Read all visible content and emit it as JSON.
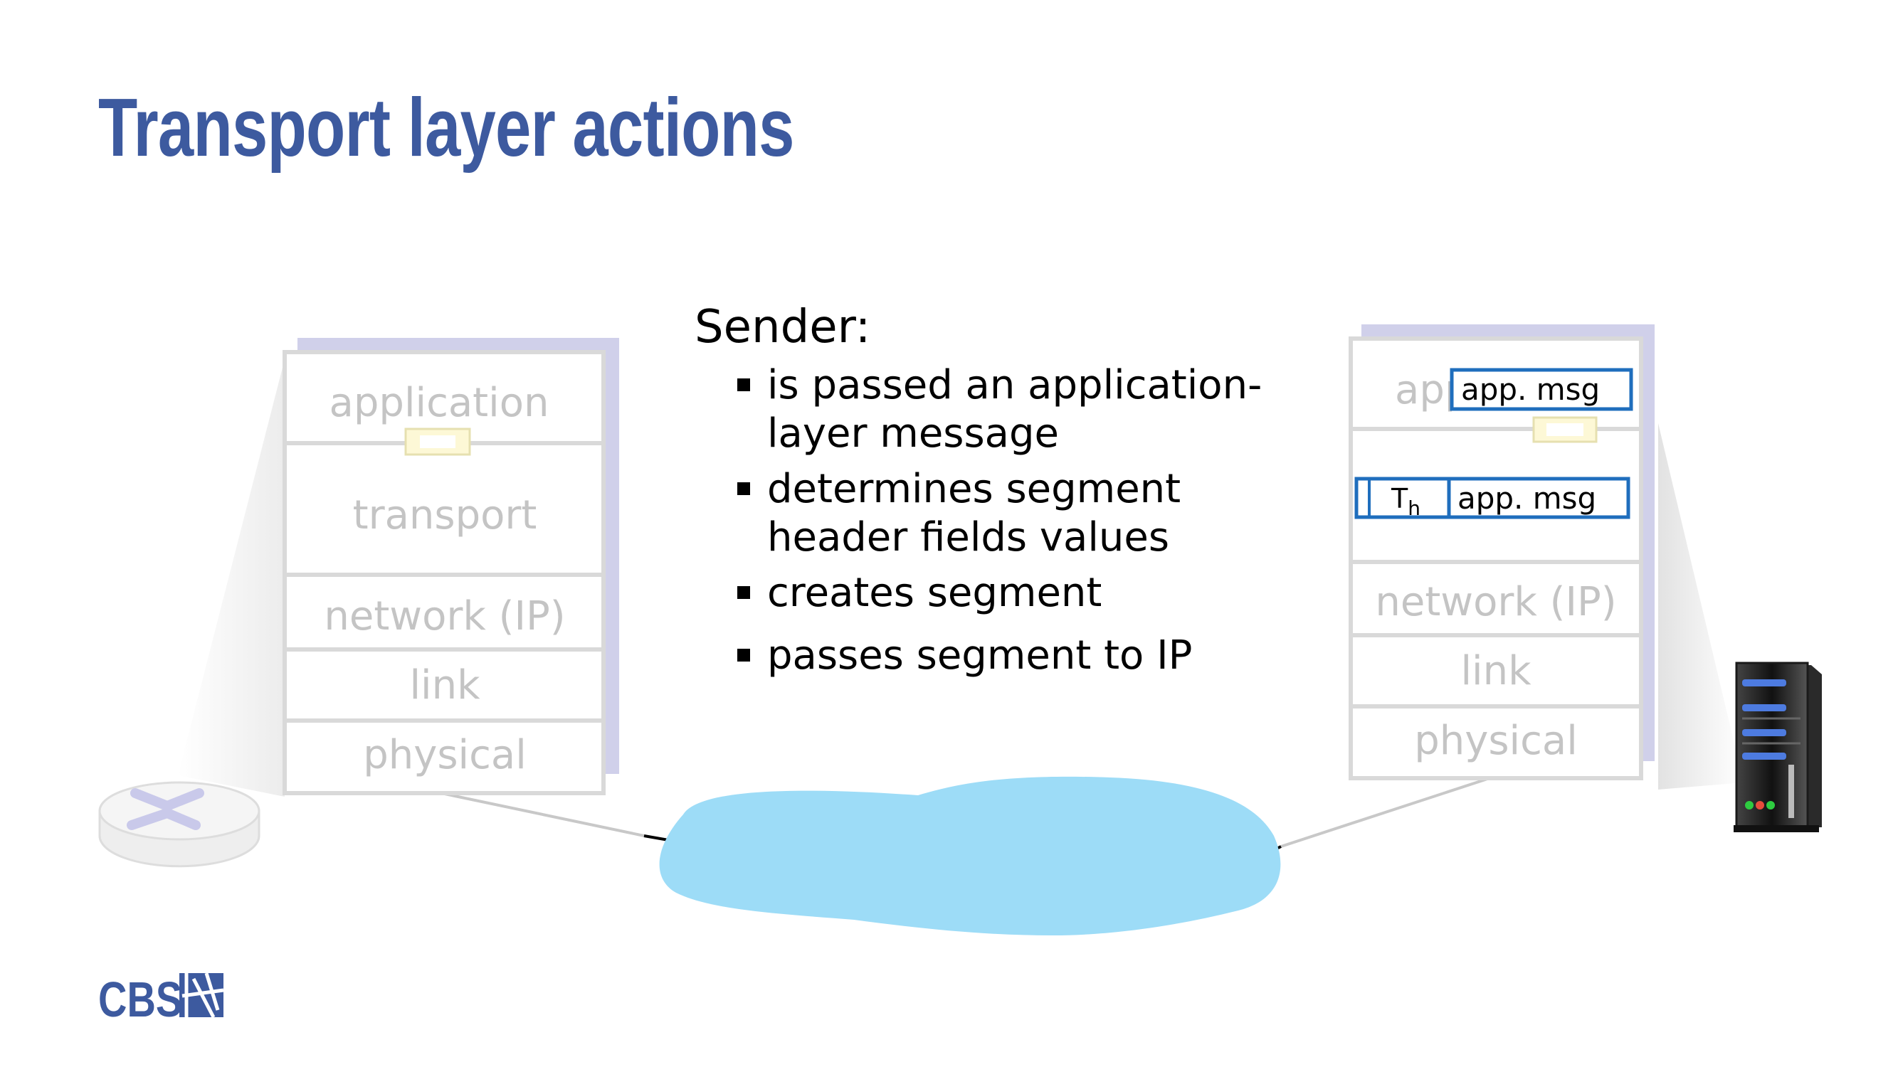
{
  "slide": {
    "title": "Transport layer actions"
  },
  "left_stack": {
    "layers": [
      "application",
      "transport",
      "network (IP)",
      "link",
      "physical"
    ]
  },
  "right_stack": {
    "layers": [
      "app",
      "",
      "network (IP)",
      "link",
      "physical"
    ]
  },
  "messages": {
    "app_msg_top": "app. msg",
    "segment_header": "T",
    "segment_header_sub": "h",
    "app_msg_segment": "app. msg"
  },
  "sender": {
    "heading": "Sender:",
    "bullets": [
      "is passed an application-layer message",
      "determines segment header fields values",
      "creates segment",
      "passes segment to IP"
    ]
  },
  "logo": {
    "text": "CBS"
  },
  "colors": {
    "title": "#3d5a9f",
    "cloud": "#9ddcf7",
    "box_border": "#1f6ebd",
    "stack_shadow": "#d0d0ea",
    "layer_text": "#c4c4c4"
  }
}
